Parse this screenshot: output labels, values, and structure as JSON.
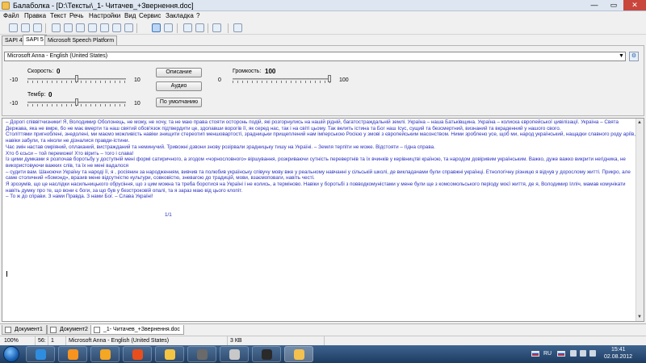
{
  "window": {
    "title": "Балаболка - [D:\\Тексты\\_1- Читачев_+Звернення.doc]",
    "min_glyph": "—",
    "max_glyph": "▭",
    "close_glyph": "✕"
  },
  "menu": [
    "Файл",
    "Правка",
    "Текст",
    "Речь",
    "Настройки",
    "Вид",
    "Сервис",
    "Закладка",
    "?"
  ],
  "engine_tabs": [
    "SAPI 4",
    "SAPI 5",
    "Microsoft Speech Platform"
  ],
  "voice": {
    "selected": "Microsoft Anna - English (United States)",
    "arrow": "▼",
    "settings_glyph": "⚙"
  },
  "controls": {
    "rate": {
      "label": "Скорость:",
      "value": "0",
      "min": "-10",
      "max": "10",
      "position": 0.5
    },
    "pitch": {
      "label": "Тембр:",
      "value": "0",
      "min": "-10",
      "max": "10",
      "position": 0.5
    },
    "volume": {
      "label": "Громкость:",
      "value": "100",
      "min": "0",
      "max": "100",
      "position": 1.0
    },
    "buttons": [
      "Описание",
      "Аудио",
      "По умолчанию"
    ]
  },
  "editor": {
    "paragraphs": [
      "     – Дорогі співвітчизники! Я, Володимир Оболонець, не можу, не хочу, та не маю права стояти осторонь подій, які розгорнулись на нашій рідній, багатостраждальній землі.                         Україна – наша Батьківщина. Україна – колиска європейської цивілізації. Україна – Свята Держава, яка не вмре, бо не має вмерти та наш святий обов'язок підтвердити це, здолавши ворогів її, як серед нас, так і  на світі цьому. Так велить істина та Бог наш Ісус, сущий та безсмертний, визнаний та вкраденний у нашого свого.",
      "Століттями пригноблені, знедолені, ми маємо можливість навіки знищити стереотип меншовартості, зрадницьки прищеплений нам імперською Росією у змові з європейським масонством. Ними зроблено усе, щоб ми, народ український, нащадки славного роду аріїв, навіки забули, та ніколи не дізналися правди-істини.",
      "Час змін настав омріяний, оплаканий, вистражданий та неминучий. Тривожні дзвони знову розірвали зрадницьку тишу на Україні.          – Земля терпіти не може. Відстояти – гідна справа.",
      "Хто б єсьси – той переможе! Хто вірить – того і слава!",
      "Із цими думками я розпочав боротьбу у доступній мені формі сатиричного, а згодом «чорнословного» віршування, розкриваючи сутність перевертнів та їх вчинків у керівництві країною, та народом довіривим українським. Важко, дуже важко викрити негідника, не використовуючи важких слів, та їх не мені вадалося",
      "– судити вам. Шаноючи Україну та народі її, я , росіянин за народженням, вивчив та полюбив українську співучу мову вже у реальному навчанні у сільській школі, де викладачами були справжні українці.  Етнологічну різницю я відчув у дорослому житті. Прикро, але саме  столичний «бомонд», вразив мене відсутністю культури, совковістю,  зневагою до традицій, мови, взаємоповаги, навіть честі.",
      "     Я зрозумів, що це наслідки насильницького обрусіння, що з цим можна та треба боротися на Україні і не колись, а терміново. Навіки у боротьбі з повводкомуністами у мене були ще з комсомольського періоду моєї життя, де я, Володимир Ілліч, мамав комунікати навіть думку про те, що вони є боги, за що був у безстроковій опалі, та я зараз маю від цього клопіт.",
      "– То ж до справи. З нами Правда. З нами Бог. – Слава Україні!"
    ],
    "page_indicator": "1/1",
    "scroll_up": "▲",
    "scroll_down": "▼"
  },
  "doc_tabs": [
    "Документ1",
    "Документ2",
    "_1- Читачев_+Звернення.doc"
  ],
  "status": {
    "zoom": "100%",
    "line": "56:",
    "col": "1",
    "voice": "Microsoft Anna - English (United States)",
    "size": "3 КВ"
  },
  "taskbar": {
    "clock_time": "15:41",
    "clock_date": "02.08.2012",
    "lang": "RU",
    "app_colors": [
      "#2f8de0",
      "#f7931e",
      "#f5a623",
      "#e84e1b",
      "#f4c542",
      "#6a6a6a",
      "#c8c8c8",
      "#2a2a2a",
      "#f2c14e"
    ]
  }
}
